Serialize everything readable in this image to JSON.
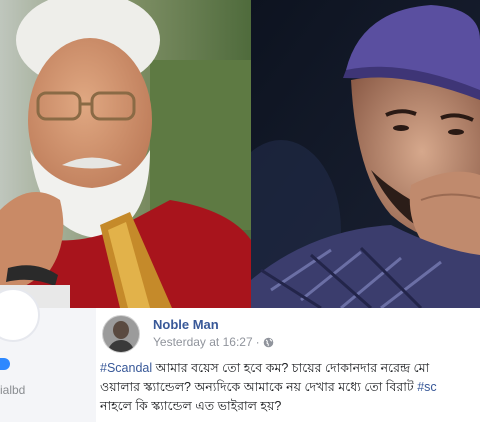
{
  "profile_fragment": {
    "handle_fragment": "ialbd"
  },
  "post": {
    "author_name": "Noble Man",
    "timestamp": "Yesterday at 16:27",
    "separator": "·",
    "privacy_icon": "globe-icon",
    "text_lines": [
      {
        "hashtag": "#Scandal",
        "text": " আমার বয়েস তো হবে কম? চায়ের দোকানদার নরেন্দ্র মো"
      },
      {
        "hashtag": "",
        "text": "ওয়ালার স্ক্যান্ডেল? অন্যদিকে আমাকে নয় দেখার মধ্যে তো বিরাট ",
        "hashtag_tail": "#sc"
      },
      {
        "hashtag": "",
        "text": "নাহলে কি স্ক্যান্ডেল এত ভাইরাল হয়?"
      }
    ]
  },
  "colors": {
    "link_blue": "#385898",
    "meta_gray": "#90949c",
    "badge_blue": "#2d88ff"
  }
}
